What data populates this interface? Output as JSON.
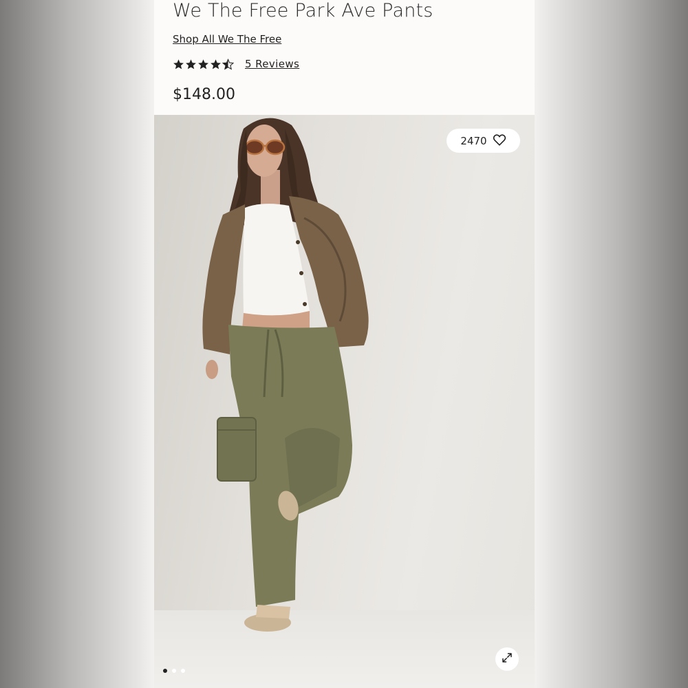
{
  "product": {
    "title": "We The Free Park Ave Pants",
    "shop_link": "Shop All We The Free",
    "rating": 4.5,
    "reviews_link": "5 Reviews",
    "price": "$148.00"
  },
  "gallery": {
    "like_count": "2470",
    "like_icon": "heart-icon",
    "expand_icon": "expand-icon",
    "slide_count": 3,
    "active_slide": 1
  },
  "colors": {
    "jacket": "#7a6248",
    "pants": "#7b7c57",
    "top": "#f6f5f1",
    "accent": "#222222"
  }
}
